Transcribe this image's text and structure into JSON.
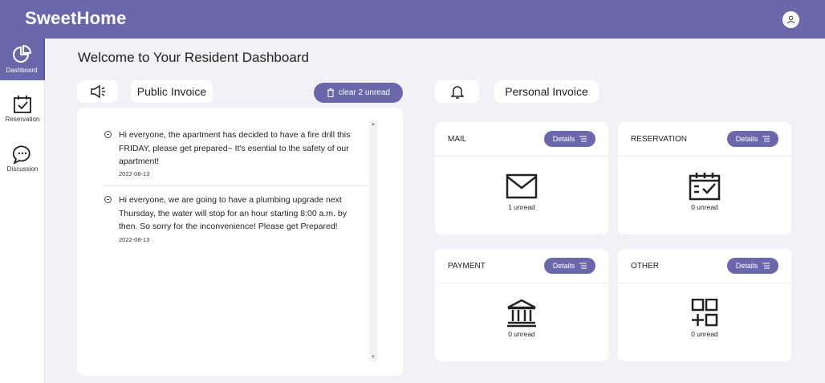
{
  "app": {
    "brand": "SweetHome"
  },
  "sidebar": {
    "items": [
      {
        "label": "Dashboard",
        "icon": "pie-chart-icon",
        "active": true
      },
      {
        "label": "Reservation",
        "icon": "calendar-check-icon",
        "active": false
      },
      {
        "label": "Discussion",
        "icon": "chat-bubbles-icon",
        "active": false
      }
    ]
  },
  "main": {
    "title": "Welcome to Your Resident Dashboard",
    "public": {
      "icon": "megaphone-icon",
      "label": "Public Invoice",
      "clear_label": "clear 2 unread",
      "notices": [
        {
          "text": "Hi everyone, the apartment has decided to have a fire drill this FRIDAY, please get prepared~ It's esential to the safety of our apartment!",
          "date": "2022-08-13"
        },
        {
          "text": "Hi everyone, we are going to have a plumbing upgrade next Thursday, the water will stop for an hour starting 8:00 a.m. by then. So sorry for the inconvenience! Please get Prepared!",
          "date": "2022-08-13"
        }
      ]
    },
    "personal": {
      "icon": "bell-icon",
      "label": "Personal Invoice",
      "cards": [
        {
          "title": "MAIL",
          "details": "Details",
          "icon": "envelope-icon",
          "count": "1 unread"
        },
        {
          "title": "RESERVATION",
          "details": "Details",
          "icon": "calendar-check-icon",
          "count": "0 unread"
        },
        {
          "title": "PAYMENT",
          "details": "Details",
          "icon": "bank-icon",
          "count": "0 unread"
        },
        {
          "title": "OTHER",
          "details": "Details",
          "icon": "grid-plus-icon",
          "count": "0 unread"
        }
      ]
    }
  },
  "colors": {
    "accent": "#6b67ab",
    "background": "#f2f2f6"
  }
}
